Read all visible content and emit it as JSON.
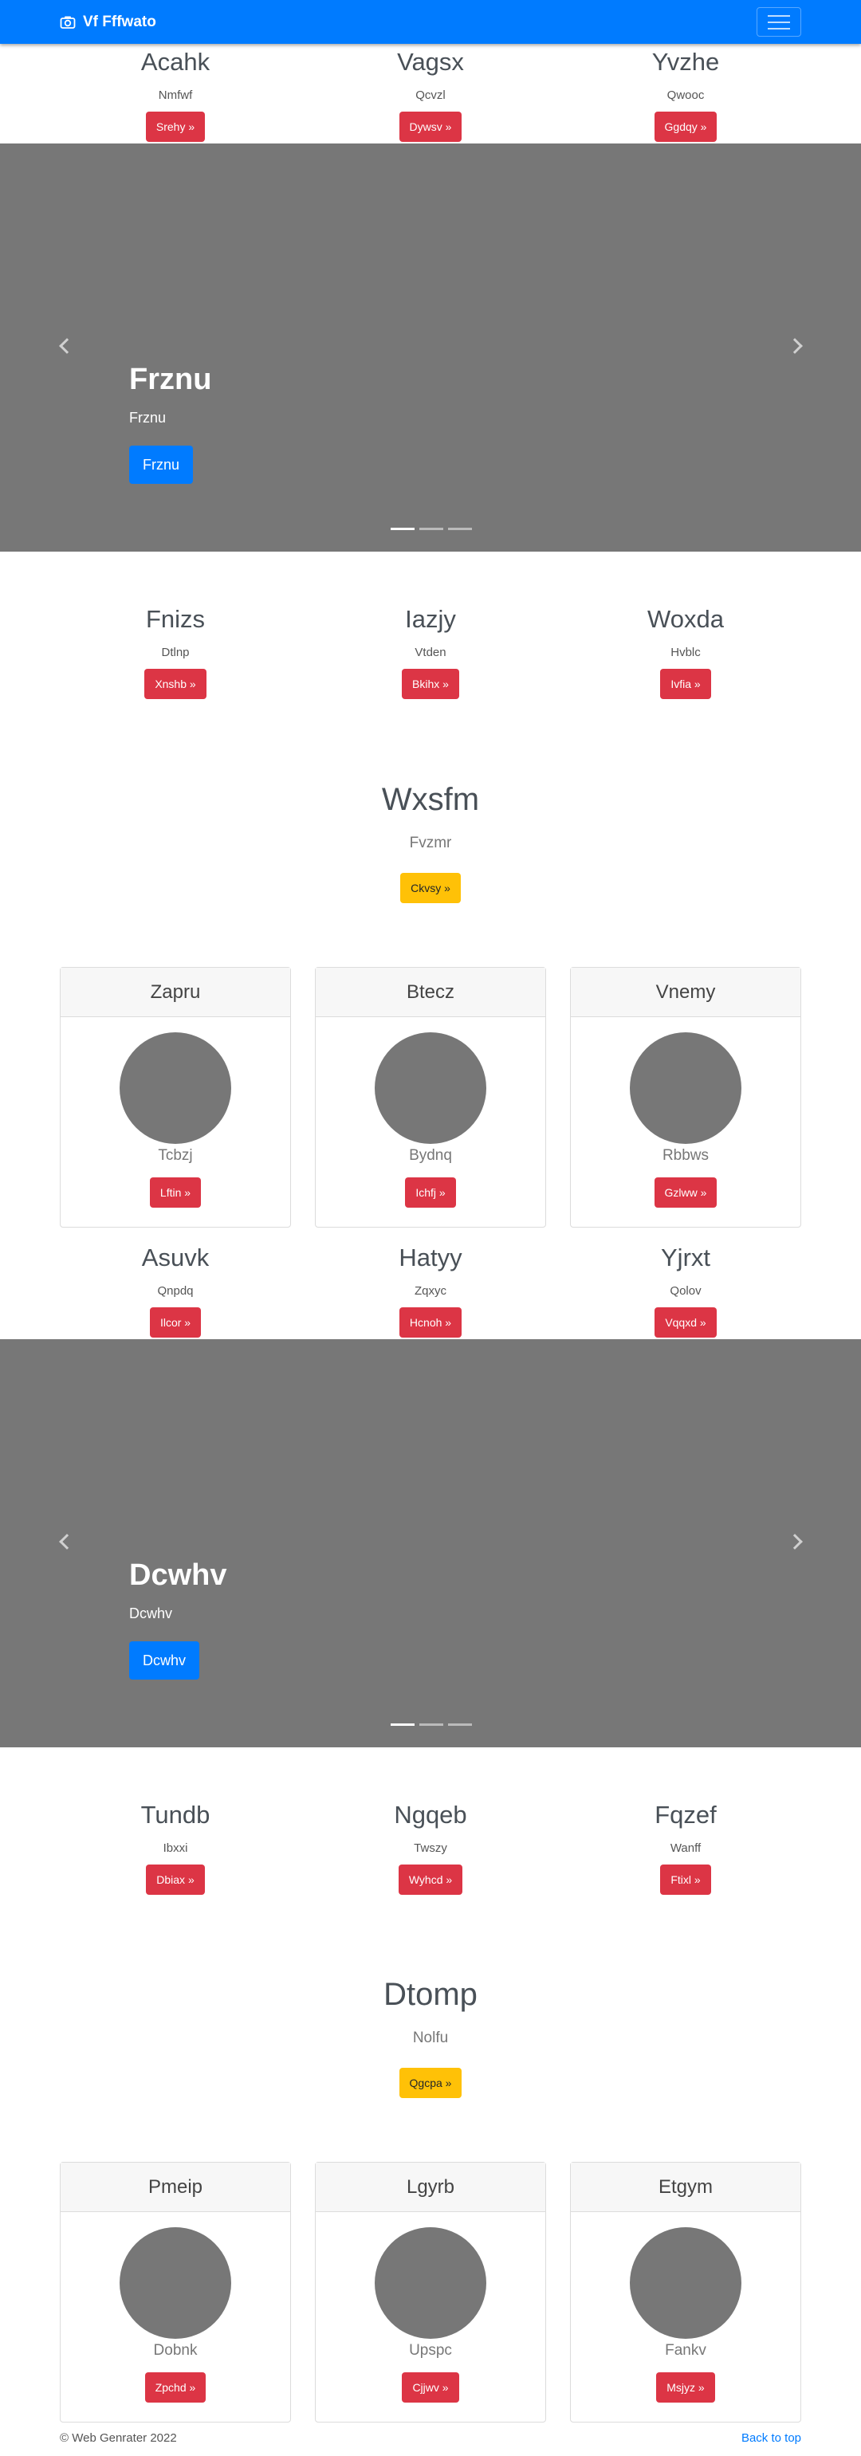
{
  "navbar": {
    "brand": "Vf Fffwato"
  },
  "row1": [
    {
      "title": "Acahk",
      "text": "Nmfwf",
      "button": "Srehy »"
    },
    {
      "title": "Vagsx",
      "text": "Qcvzl",
      "button": "Dywsv »"
    },
    {
      "title": "Yvzhe",
      "text": "Qwooc",
      "button": "Ggdqy »"
    }
  ],
  "carousel1": {
    "title": "Frznu",
    "text": "Frznu",
    "button": "Frznu"
  },
  "row2": [
    {
      "title": "Fnizs",
      "text": "Dtlnp",
      "button": "Xnshb »"
    },
    {
      "title": "Iazjy",
      "text": "Vtden",
      "button": "Bkihx »"
    },
    {
      "title": "Woxda",
      "text": "Hvblc",
      "button": "Ivfia »"
    }
  ],
  "feature1": {
    "title": "Wxsfm",
    "text": "Fvzmr",
    "button": "Ckvsy »"
  },
  "cards1": [
    {
      "header": "Zapru",
      "text": "Tcbzj",
      "button": "Lftin »"
    },
    {
      "header": "Btecz",
      "text": "Bydnq",
      "button": "Ichfj »"
    },
    {
      "header": "Vnemy",
      "text": "Rbbws",
      "button": "Gzlww »"
    }
  ],
  "row3": [
    {
      "title": "Asuvk",
      "text": "Qnpdq",
      "button": "Ilcor »"
    },
    {
      "title": "Hatyy",
      "text": "Zqxyc",
      "button": "Hcnoh »"
    },
    {
      "title": "Yjrxt",
      "text": "Qolov",
      "button": "Vqqxd »"
    }
  ],
  "carousel2": {
    "title": "Dcwhv",
    "text": "Dcwhv",
    "button": "Dcwhv"
  },
  "row4": [
    {
      "title": "Tundb",
      "text": "Ibxxi",
      "button": "Dbiax »"
    },
    {
      "title": "Ngqeb",
      "text": "Twszy",
      "button": "Wyhcd »"
    },
    {
      "title": "Fqzef",
      "text": "Wanff",
      "button": "Ftixl »"
    }
  ],
  "feature2": {
    "title": "Dtomp",
    "text": "Nolfu",
    "button": "Qgcpa »"
  },
  "cards2": [
    {
      "header": "Pmeip",
      "text": "Dobnk",
      "button": "Zpchd »"
    },
    {
      "header": "Lgyrb",
      "text": "Upspc",
      "button": "Cjjwv »"
    },
    {
      "header": "Etgym",
      "text": "Fankv",
      "button": "Msjyz »"
    }
  ],
  "footer": {
    "copyright": "© Web Genrater 2022",
    "back_to_top": "Back to top"
  },
  "colors": {
    "primary": "#007bff",
    "danger": "#dc3545",
    "warning": "#ffc107",
    "placeholder": "#777777"
  },
  "icons": {
    "brand": "camera-icon",
    "carousel_prev": "chevron-left-icon",
    "carousel_next": "chevron-right-icon",
    "menu": "hamburger-menu-icon"
  }
}
